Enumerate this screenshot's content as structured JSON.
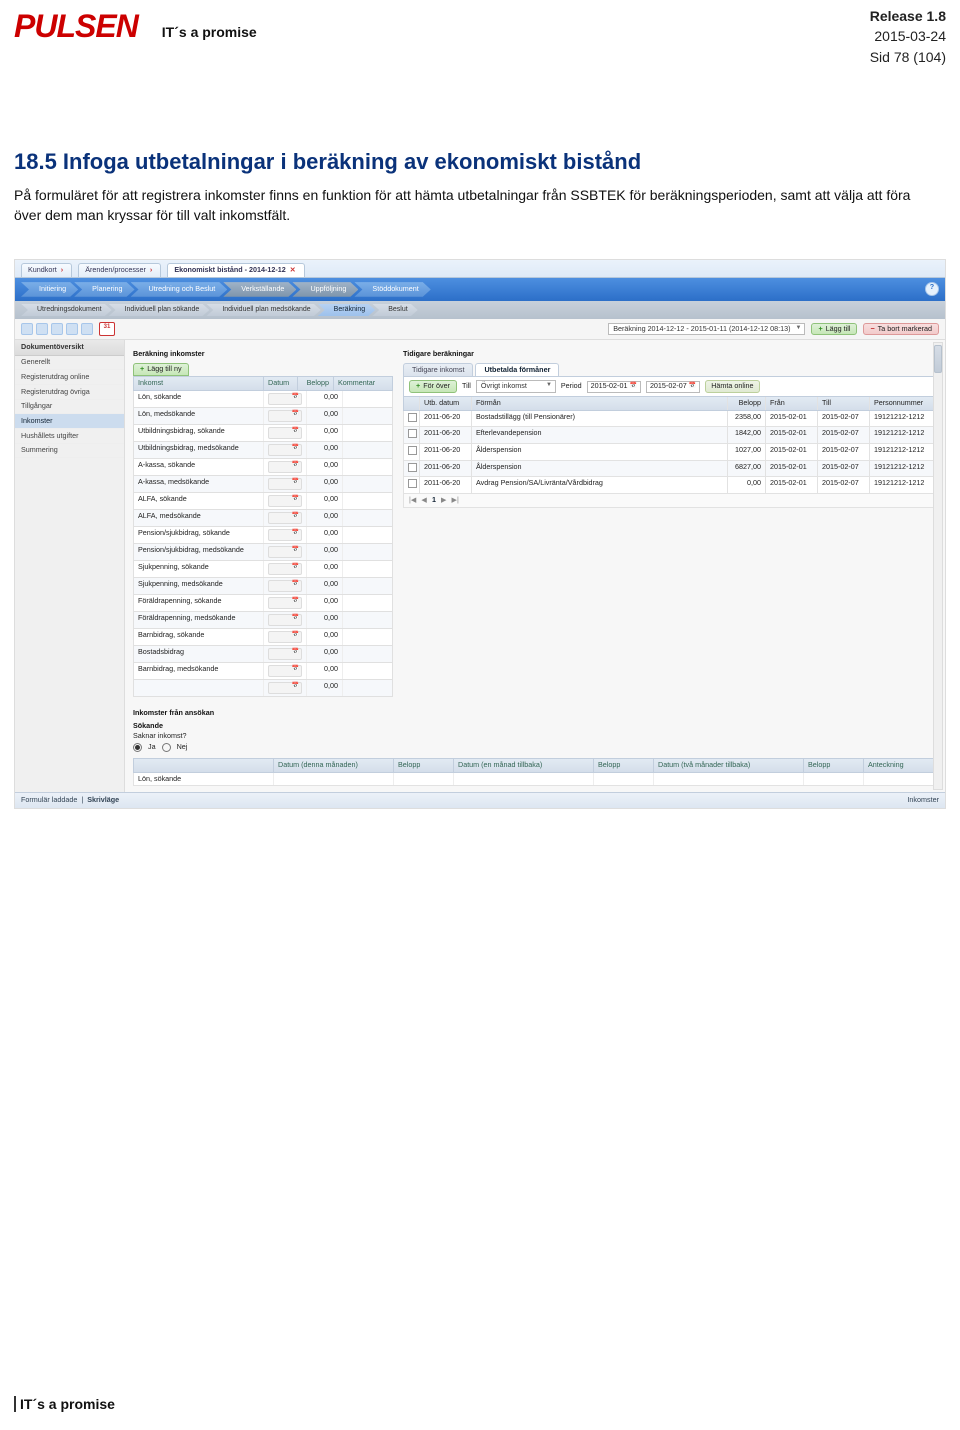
{
  "header": {
    "logo": "PULSEN",
    "promise": "IT´s a promise",
    "release": "Release 1.8",
    "date": "2015-03-24",
    "page": "Sid 78 (104)"
  },
  "section": {
    "title": "18.5 Infoga utbetalningar i beräkning av ekonomiskt bistånd",
    "paragraph": "På formuläret för att registrera inkomster finns en funktion för att hämta utbetalningar från SSBTEK för beräkningsperioden, samt att välja att föra över dem man kryssar för till valt inkomstfält."
  },
  "app": {
    "tabs": {
      "kundkort": "Kundkort",
      "arenden": "Ärenden/processer",
      "ekonomiskt": "Ekonomiskt bistånd - 2014-12-12",
      "close_x": "✕"
    },
    "flow": {
      "initiering": "Initiering",
      "planering": "Planering",
      "utredning_beslut": "Utredning och Beslut",
      "verkstallande": "Verkställande",
      "uppfoljning": "Uppföljning",
      "stoddokument": "Stöddokument"
    },
    "subflow": {
      "utredningsdokument": "Utredningsdokument",
      "individuell_sokande": "Individuell plan sökande",
      "individuell_medsokande": "Individuell plan medsökande",
      "berakning": "Beräkning",
      "beslut": "Beslut"
    },
    "toolbar": {
      "period_label": "Beräkning 2014-12-12 - 2015-01-11 (2014-12-12 08:13)",
      "lagg_till": "Lägg till",
      "ta_bort": "Ta bort markerad",
      "cal": "31",
      "help": "?"
    },
    "sidebar": {
      "title": "Dokumentöversikt",
      "items": [
        "Generellt",
        "Registerutdrag online",
        "Registerutdrag övriga",
        "Tillgångar",
        "Inkomster",
        "Hushållets utgifter",
        "Summering"
      ],
      "selected_index": 4
    },
    "inkomster": {
      "heading": "Beräkning inkomster",
      "add_new": "Lägg till ny",
      "cols": {
        "inkomst": "Inkomst",
        "datum": "Datum",
        "belopp": "Belopp",
        "kommentar": "Kommentar"
      },
      "rows": [
        {
          "name": "Lön, sökande",
          "belopp": "0,00"
        },
        {
          "name": "Lön, medsökande",
          "belopp": "0,00"
        },
        {
          "name": "Utbildningsbidrag, sökande",
          "belopp": "0,00"
        },
        {
          "name": "Utbildningsbidrag, medsökande",
          "belopp": "0,00"
        },
        {
          "name": "A-kassa, sökande",
          "belopp": "0,00"
        },
        {
          "name": "A-kassa, medsökande",
          "belopp": "0,00"
        },
        {
          "name": "ALFA, sökande",
          "belopp": "0,00"
        },
        {
          "name": "ALFA, medsökande",
          "belopp": "0,00"
        },
        {
          "name": "Pension/sjukbidrag, sökande",
          "belopp": "0,00"
        },
        {
          "name": "Pension/sjukbidrag, medsökande",
          "belopp": "0,00"
        },
        {
          "name": "Sjukpenning, sökande",
          "belopp": "0,00"
        },
        {
          "name": "Sjukpenning, medsökande",
          "belopp": "0,00"
        },
        {
          "name": "Föräldrapenning, sökande",
          "belopp": "0,00"
        },
        {
          "name": "Föräldrapenning, medsökande",
          "belopp": "0,00"
        },
        {
          "name": "Barnbidrag, sökande",
          "belopp": "0,00"
        },
        {
          "name": "Bostadsbidrag",
          "belopp": "0,00"
        },
        {
          "name": "Barnbidrag, medsökande",
          "belopp": "0,00"
        },
        {
          "name": "",
          "belopp": "0,00"
        }
      ]
    },
    "tidigare": {
      "heading": "Tidigare beräkningar",
      "tab_inkomst": "Tidigare inkomst",
      "tab_formaner": "Utbetalda förmåner",
      "for_over_label": "För över",
      "for_over_till": "Till",
      "for_over_value": "Övrigt inkomst",
      "period_label": "Period",
      "period_from": "2015-02-01",
      "period_to": "2015-02-07",
      "fetch": "Hämta online",
      "cols": {
        "utb": "Utb. datum",
        "forman": "Förmån",
        "belopp": "Belopp",
        "fran": "Från",
        "till": "Till",
        "person": "Personnummer"
      },
      "rows": [
        {
          "utb": "2011-06-20",
          "forman": "Bostadstillägg (till Pensionärer)",
          "belopp": "2358,00",
          "fran": "2015-02-01",
          "till": "2015-02-07",
          "person": "19121212-1212"
        },
        {
          "utb": "2011-06-20",
          "forman": "Efterlevandepension",
          "belopp": "1842,00",
          "fran": "2015-02-01",
          "till": "2015-02-07",
          "person": "19121212-1212"
        },
        {
          "utb": "2011-06-20",
          "forman": "Ålderspension",
          "belopp": "1027,00",
          "fran": "2015-02-01",
          "till": "2015-02-07",
          "person": "19121212-1212"
        },
        {
          "utb": "2011-06-20",
          "forman": "Ålderspension",
          "belopp": "6827,00",
          "fran": "2015-02-01",
          "till": "2015-02-07",
          "person": "19121212-1212"
        },
        {
          "utb": "2011-06-20",
          "forman": "Avdrag Pension/SA/Livränta/Vårdbidrag",
          "belopp": "0,00",
          "fran": "2015-02-01",
          "till": "2015-02-07",
          "person": "19121212-1212"
        }
      ],
      "pager": {
        "first": "|◀",
        "prev": "◀",
        "page": "1",
        "next": "▶",
        "last": "▶|"
      }
    },
    "ansokan": {
      "heading": "Inkomster från ansökan",
      "sokande": "Sökande",
      "saknar": "Saknar inkomst?",
      "ja": "Ja",
      "nej": "Nej",
      "cols": {
        "a": "",
        "b": "Datum (denna månaden)",
        "c": "Belopp",
        "d": "Datum (en månad tillbaka)",
        "e": "Belopp",
        "f": "Datum (två månader tillbaka)",
        "g": "Belopp",
        "h": "Anteckning"
      },
      "row1": "Lön, sökande"
    },
    "status": {
      "left_a": "Formulär laddade",
      "left_b": "Skrivläge",
      "right": "Inkomster"
    }
  },
  "footer": {
    "promise": "IT´s a promise"
  }
}
